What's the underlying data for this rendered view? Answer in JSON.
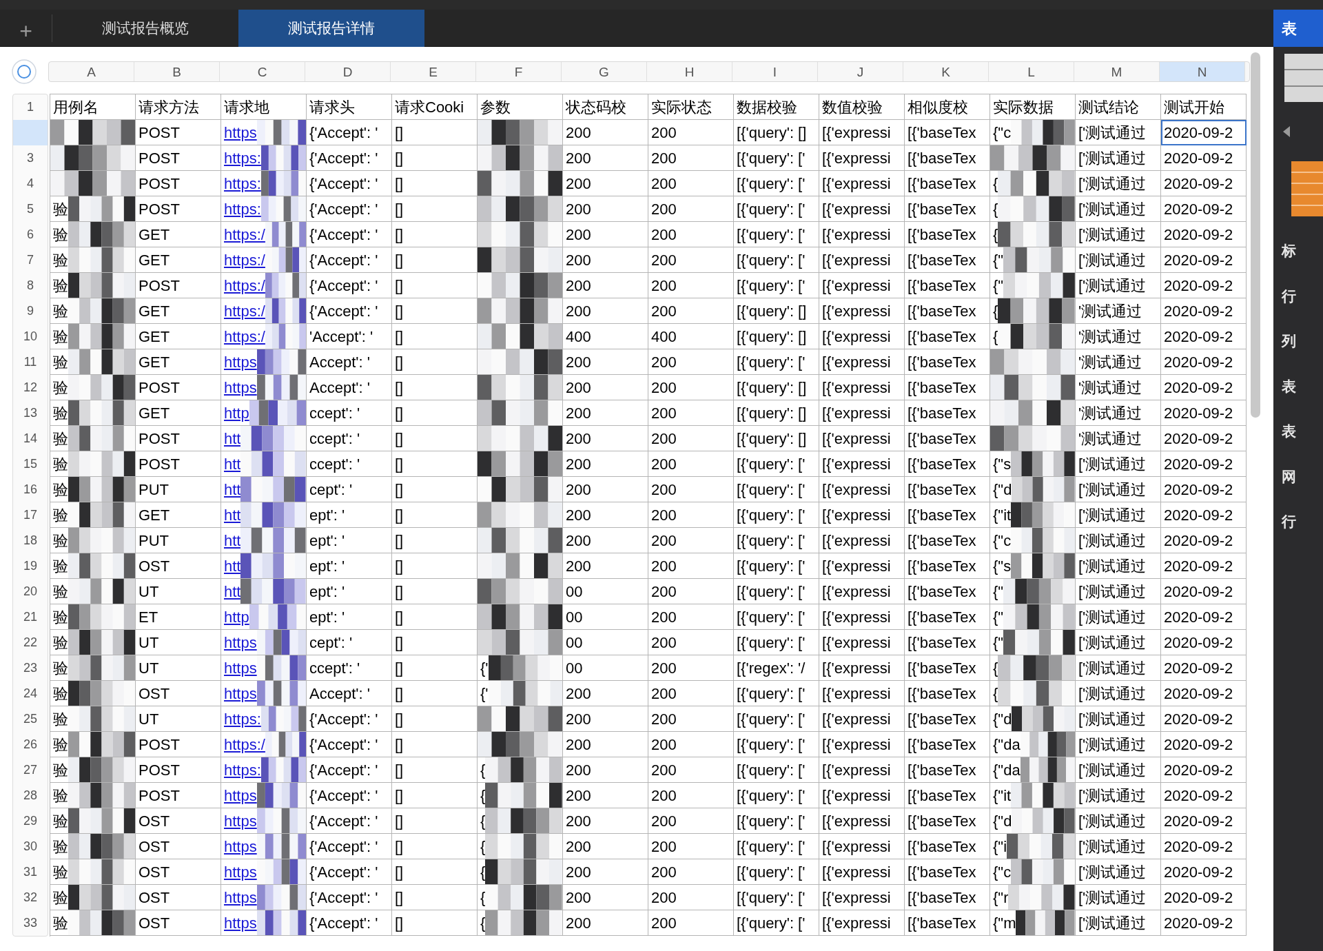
{
  "tabs": [
    {
      "label": "测试报告概览",
      "selected": false
    },
    {
      "label": "测试报告详情",
      "selected": true
    }
  ],
  "add_tab": "+",
  "sheet": {
    "columns": [
      {
        "label": "A",
        "selected": false
      },
      {
        "label": "B",
        "selected": false
      },
      {
        "label": "C",
        "selected": false
      },
      {
        "label": "D",
        "selected": false
      },
      {
        "label": "E",
        "selected": false
      },
      {
        "label": "F",
        "selected": false
      },
      {
        "label": "G",
        "selected": false
      },
      {
        "label": "H",
        "selected": false
      },
      {
        "label": "I",
        "selected": false
      },
      {
        "label": "J",
        "selected": false
      },
      {
        "label": "K",
        "selected": false
      },
      {
        "label": "L",
        "selected": false
      },
      {
        "label": "M",
        "selected": false
      },
      {
        "label": "N",
        "selected": true
      }
    ],
    "header_row": {
      "number": "1",
      "a": "用例名",
      "b": "请求方法",
      "c": "请求地",
      "d": "请求头",
      "e": "请求Cooki",
      "f": "参数",
      "g": "状态码校",
      "h": "实际状态",
      "i": "数据校验",
      "j": "数值校验",
      "k": "相似度校",
      "l": "实际数据",
      "m": "测试结论",
      "n": "测试开始"
    },
    "rows": [
      {
        "selected": true,
        "b": "POST",
        "c": "https",
        "d": "{'Accept': '",
        "e": "[]",
        "g": "200",
        "h": "200",
        "i": "[{'query': []",
        "j": "[{'expressi",
        "k": "[{'baseTex",
        "l": "{\"c",
        "m": "['测试通过",
        "n": "2020-09-2"
      },
      {
        "number": "3",
        "selected": false,
        "b": "POST",
        "c": "https:",
        "d": "{'Accept': '",
        "e": "[]",
        "g": "200",
        "h": "200",
        "i": "[{'query': ['",
        "j": "[{'expressi",
        "k": "[{'baseTex",
        "m": "['测试通过",
        "n": "2020-09-2"
      },
      {
        "number": "4",
        "selected": false,
        "b": "POST",
        "c": "https:",
        "d": "{'Accept': '",
        "e": "[]",
        "g": "200",
        "h": "200",
        "i": "[{'query': ['",
        "j": "[{'expressi",
        "k": "[{'baseTex",
        "l": "{",
        "m": "['测试通过",
        "n": "2020-09-2"
      },
      {
        "number": "5",
        "selected": false,
        "a": "验",
        "b": "POST",
        "c": "https:",
        "d": "{'Accept': '",
        "e": "[]",
        "g": "200",
        "h": "200",
        "i": "[{'query': ['",
        "j": "[{'expressi",
        "k": "[{'baseTex",
        "l": "{",
        "m": "['测试通过",
        "n": "2020-09-2"
      },
      {
        "number": "6",
        "selected": false,
        "a": "验",
        "b": "GET",
        "c": "https:/",
        "d": "{'Accept': '",
        "e": "[]",
        "g": "200",
        "h": "200",
        "i": "[{'query': ['",
        "j": "[{'expressi",
        "k": "[{'baseTex",
        "l": "{",
        "m": "['测试通过",
        "n": "2020-09-2"
      },
      {
        "number": "7",
        "selected": false,
        "a": "验",
        "b": "GET",
        "c": "https:/",
        "d": "{'Accept': '",
        "e": "[]",
        "g": "200",
        "h": "200",
        "i": "[{'query': ['",
        "j": "[{'expressi",
        "k": "[{'baseTex",
        "l": "{\"",
        "m": "['测试通过",
        "n": "2020-09-2"
      },
      {
        "number": "8",
        "selected": false,
        "a": "验",
        "b": "POST",
        "c": "https:/",
        "d": "{'Accept': '",
        "e": "[]",
        "g": "200",
        "h": "200",
        "i": "[{'query': ['",
        "j": "[{'expressi",
        "k": "[{'baseTex",
        "l": "{\"",
        "m": "['测试通过",
        "n": "2020-09-2"
      },
      {
        "number": "9",
        "selected": false,
        "a": "验",
        "b": "GET",
        "c": "https:/",
        "d": "{'Accept': '",
        "e": "[]",
        "g": "200",
        "h": "200",
        "i": "[{'query': []",
        "j": "[{'expressi",
        "k": "[{'baseTex",
        "l": "{",
        "m": "'测试通过",
        "n": "2020-09-2"
      },
      {
        "number": "10",
        "selected": false,
        "a": "验",
        "b": "GET",
        "c": "https:/",
        "d": "'Accept': '",
        "e": "[]",
        "g": "400",
        "h": "400",
        "i": "[{'query': []",
        "j": "[{'expressi",
        "k": "[{'baseTex",
        "l": "{",
        "m": "'测试通过",
        "n": "2020-09-2"
      },
      {
        "number": "11",
        "selected": false,
        "a": "验",
        "b": "GET",
        "c": "https",
        "d": "Accept': '",
        "e": "[]",
        "g": "200",
        "h": "200",
        "i": "[{'query': ['",
        "j": "[{'expressi",
        "k": "[{'baseTex",
        "m": "'测试通过",
        "n": "2020-09-2"
      },
      {
        "number": "12",
        "selected": false,
        "a": "验",
        "b": "POST",
        "c": "https",
        "d": "Accept': '",
        "e": "[]",
        "g": "200",
        "h": "200",
        "i": "[{'query': []",
        "j": "[{'expressi",
        "k": "[{'baseTex",
        "m": "'测试通过",
        "n": "2020-09-2"
      },
      {
        "number": "13",
        "selected": false,
        "a": "验",
        "b": "GET",
        "c": "http",
        "d": "ccept': '",
        "e": "[]",
        "g": "200",
        "h": "200",
        "i": "[{'query': []",
        "j": "[{'expressi",
        "k": "[{'baseTex",
        "m": "'测试通过",
        "n": "2020-09-2"
      },
      {
        "number": "14",
        "selected": false,
        "a": "验",
        "b": "POST",
        "c": "htt",
        "d": "ccept': '",
        "e": "[]",
        "g": "200",
        "h": "200",
        "i": "[{'query': []",
        "j": "[{'expressi",
        "k": "[{'baseTex",
        "m": "'测试通过",
        "n": "2020-09-2"
      },
      {
        "number": "15",
        "selected": false,
        "a": "验",
        "b": "POST",
        "c": "htt",
        "d": "ccept': '",
        "e": "[]",
        "g": "200",
        "h": "200",
        "i": "[{'query': ['",
        "j": "[{'expressi",
        "k": "[{'baseTex",
        "l": "{\"s",
        "m": "['测试通过",
        "n": "2020-09-2"
      },
      {
        "number": "16",
        "selected": false,
        "a": "验",
        "b": "PUT",
        "c": "htt",
        "d": "cept': '",
        "e": "[]",
        "g": "200",
        "h": "200",
        "i": "[{'query': ['",
        "j": "[{'expressi",
        "k": "[{'baseTex",
        "l": "{\"d",
        "m": "['测试通过",
        "n": "2020-09-2"
      },
      {
        "number": "17",
        "selected": false,
        "a": "验",
        "b": "GET",
        "c": "htt",
        "d": "ept': '",
        "e": "[]",
        "g": "200",
        "h": "200",
        "i": "[{'query': ['",
        "j": "[{'expressi",
        "k": "[{'baseTex",
        "l": "{\"it",
        "m": "['测试通过",
        "n": "2020-09-2"
      },
      {
        "number": "18",
        "selected": false,
        "a": "验",
        "b": "PUT",
        "c": "htt",
        "d": "ept': '",
        "e": "[]",
        "g": "200",
        "h": "200",
        "i": "[{'query': ['",
        "j": "[{'expressi",
        "k": "[{'baseTex",
        "l": "{\"c",
        "m": "['测试通过",
        "n": "2020-09-2"
      },
      {
        "number": "19",
        "selected": false,
        "a": "验",
        "b": "OST",
        "c": "htt",
        "d": "ept': '",
        "e": "[]",
        "g": "200",
        "h": "200",
        "i": "[{'query': ['",
        "j": "[{'expressi",
        "k": "[{'baseTex",
        "l": "{\"s",
        "m": "['测试通过",
        "n": "2020-09-2"
      },
      {
        "number": "20",
        "selected": false,
        "a": "验",
        "b": "UT",
        "c": "htt",
        "d": "ept': '",
        "e": "[]",
        "g": "00",
        "h": "200",
        "i": "[{'query': ['",
        "j": "[{'expressi",
        "k": "[{'baseTex",
        "l": "{\"",
        "m": "['测试通过",
        "n": "2020-09-2"
      },
      {
        "number": "21",
        "selected": false,
        "a": "验",
        "b": "ET",
        "c": "http",
        "d": "ept': '",
        "e": "[]",
        "g": "00",
        "h": "200",
        "i": "[{'query': ['",
        "j": "[{'expressi",
        "k": "[{'baseTex",
        "l": "{\"",
        "m": "['测试通过",
        "n": "2020-09-2"
      },
      {
        "number": "22",
        "selected": false,
        "a": "验",
        "b": "UT",
        "c": "https",
        "d": "cept': '",
        "e": "[]",
        "g": "00",
        "h": "200",
        "i": "[{'query': ['",
        "j": "[{'expressi",
        "k": "[{'baseTex",
        "l": "{\"",
        "m": "['测试通过",
        "n": "2020-09-2"
      },
      {
        "number": "23",
        "selected": false,
        "a": "验",
        "b": "UT",
        "c": "https",
        "d": "ccept': '",
        "e": "[]",
        "f": "{'",
        "g": "00",
        "h": "200",
        "i": "[{'regex': '/",
        "j": "[{'expressi",
        "k": "[{'baseTex",
        "l": "{",
        "m": "['测试通过",
        "n": "2020-09-2"
      },
      {
        "number": "24",
        "selected": false,
        "a": "验",
        "b": "OST",
        "c": "https",
        "d": "Accept': '",
        "e": "[]",
        "f": "{'",
        "g": "200",
        "h": "200",
        "i": "[{'query': ['",
        "j": "[{'expressi",
        "k": "[{'baseTex",
        "l": "{",
        "m": "['测试通过",
        "n": "2020-09-2"
      },
      {
        "number": "25",
        "selected": false,
        "a": "验",
        "b": "UT",
        "c": "https:",
        "d": "{'Accept': '",
        "e": "[]",
        "g": "200",
        "h": "200",
        "i": "[{'query': ['",
        "j": "[{'expressi",
        "k": "[{'baseTex",
        "l": "{\"d",
        "m": "['测试通过",
        "n": "2020-09-2"
      },
      {
        "number": "26",
        "selected": false,
        "a": "验",
        "b": "POST",
        "c": "https:/",
        "d": "{'Accept': '",
        "e": "[]",
        "g": "200",
        "h": "200",
        "i": "[{'query': ['",
        "j": "[{'expressi",
        "k": "[{'baseTex",
        "l": "{\"da",
        "m": "['测试通过",
        "n": "2020-09-2"
      },
      {
        "number": "27",
        "selected": false,
        "a": "验",
        "b": "POST",
        "c": "https:",
        "d": "{'Accept': '",
        "e": "[]",
        "f": "{",
        "g": "200",
        "h": "200",
        "i": "[{'query': ['",
        "j": "[{'expressi",
        "k": "[{'baseTex",
        "l": "{\"da",
        "m": "['测试通过",
        "n": "2020-09-2"
      },
      {
        "number": "28",
        "selected": false,
        "a": "验",
        "b": "POST",
        "c": "https",
        "d": "{'Accept': '",
        "e": "[]",
        "f": "{",
        "g": "200",
        "h": "200",
        "i": "[{'query': ['",
        "j": "[{'expressi",
        "k": "[{'baseTex",
        "l": "{\"it",
        "m": "['测试通过",
        "n": "2020-09-2"
      },
      {
        "number": "29",
        "selected": false,
        "a": "验",
        "b": "OST",
        "c": "https",
        "d": "{'Accept': '",
        "e": "[]",
        "f": "{",
        "g": "200",
        "h": "200",
        "i": "[{'query': ['",
        "j": "[{'expressi",
        "k": "[{'baseTex",
        "l": "{\"d",
        "m": "['测试通过",
        "n": "2020-09-2"
      },
      {
        "number": "30",
        "selected": false,
        "a": "验",
        "b": "OST",
        "c": "https",
        "d": "{'Accept': '",
        "e": "[]",
        "f": "{",
        "g": "200",
        "h": "200",
        "i": "[{'query': ['",
        "j": "[{'expressi",
        "k": "[{'baseTex",
        "l": "{\"i",
        "m": "['测试通过",
        "n": "2020-09-2"
      },
      {
        "number": "31",
        "selected": false,
        "a": "验",
        "b": "OST",
        "c": "https",
        "d": "{'Accept': '",
        "e": "[]",
        "f": "{",
        "g": "200",
        "h": "200",
        "i": "[{'query': ['",
        "j": "[{'expressi",
        "k": "[{'baseTex",
        "l": "{\"c",
        "m": "['测试通过",
        "n": "2020-09-2"
      },
      {
        "number": "32",
        "selected": false,
        "a": "验",
        "b": "OST",
        "c": "https",
        "d": "{'Accept': '",
        "e": "[]",
        "f": "{",
        "g": "200",
        "h": "200",
        "i": "[{'query': ['",
        "j": "[{'expressi",
        "k": "[{'baseTex",
        "l": "{\"r",
        "m": "['测试通过",
        "n": "2020-09-2"
      },
      {
        "number": "33",
        "selected": false,
        "a": "验",
        "b": "OST",
        "c": "https",
        "d": "{'Accept': '",
        "e": "[]",
        "f": "{",
        "g": "200",
        "h": "200",
        "i": "[{'query': ['",
        "j": "[{'expressi",
        "k": "[{'baseTex",
        "l": "{\"m",
        "m": "['测试通过",
        "n": "2020-09-2"
      }
    ]
  },
  "panel": {
    "title": "表",
    "labels": [
      "标",
      "行",
      "列",
      "表",
      "表",
      "网",
      "行"
    ]
  }
}
